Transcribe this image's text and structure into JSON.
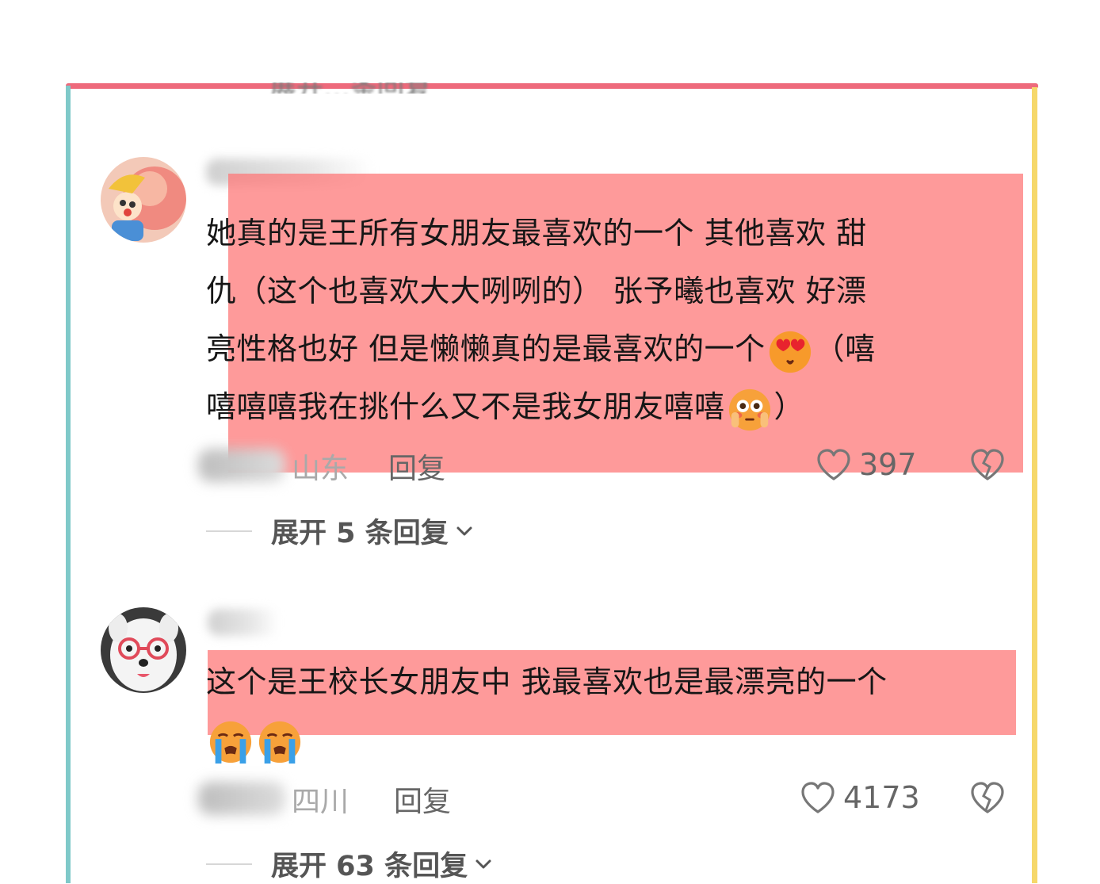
{
  "previous": {
    "expand_label": "展开…条回复"
  },
  "comments": [
    {
      "avatar_icon": "cartoon-avatar-icon",
      "lines": [
        "她真的是王所有女朋友最喜欢的一个 其他喜欢 甜",
        "仇（这个也喜欢大大咧咧的） 张予曦也喜欢 好漂",
        "亮性格也好 但是懒懒真的是最喜欢的一个",
        "（嘻",
        "嘻嘻嘻我在挑什么又不是我女朋友嘻嘻",
        "）"
      ],
      "emojis": [
        "heart-eyes-emoji-icon",
        "flushed-face-emoji-icon"
      ],
      "location": "山东",
      "reply_label": "回复",
      "likes": "397",
      "expand_label": "展开 5 条回复"
    },
    {
      "avatar_icon": "dog-with-glasses-avatar-icon",
      "lines": [
        "这个是王校长女朋友中 我最喜欢也是最漂亮的一个"
      ],
      "emojis": [
        "loudly-crying-emoji-icon",
        "loudly-crying-emoji-icon"
      ],
      "location": "四川",
      "reply_label": "回复",
      "likes": "4173",
      "expand_label": "展开 63 条回复"
    }
  ],
  "colors": {
    "highlight": "#fd7878",
    "frame_top": "#ee6a7c",
    "frame_left": "#7fc9c9",
    "frame_right": "#f6d86a"
  }
}
